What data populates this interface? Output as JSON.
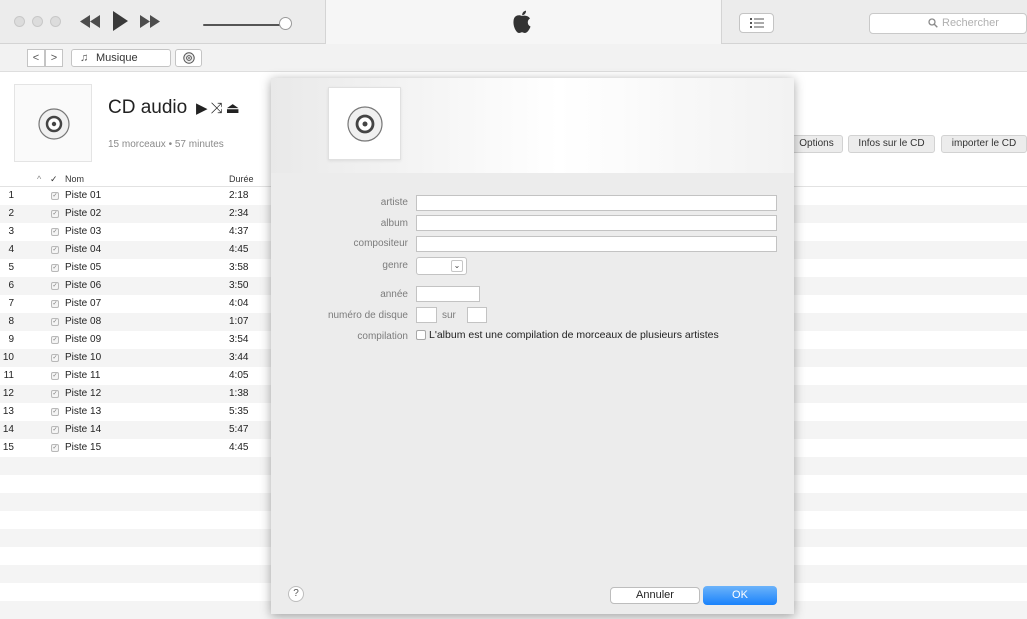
{
  "toolbar": {
    "search_placeholder": "Rechercher"
  },
  "nav": {
    "back": "<",
    "forward": ">",
    "library_label": "Musique"
  },
  "header": {
    "title": "CD audio",
    "meta": "15 morceaux • 57 minutes",
    "buttons": {
      "options": "Options",
      "cd_info": "Infos sur le CD",
      "import": "importer le CD"
    }
  },
  "tracklist": {
    "columns": {
      "check": "✓",
      "name": "Nom",
      "duration": "Durée"
    },
    "tracks": [
      {
        "num": "1",
        "name": "Piste 01",
        "duration": "2:18"
      },
      {
        "num": "2",
        "name": "Piste 02",
        "duration": "2:34"
      },
      {
        "num": "3",
        "name": "Piste 03",
        "duration": "4:37"
      },
      {
        "num": "4",
        "name": "Piste 04",
        "duration": "4:45"
      },
      {
        "num": "5",
        "name": "Piste 05",
        "duration": "3:58"
      },
      {
        "num": "6",
        "name": "Piste 06",
        "duration": "3:50"
      },
      {
        "num": "7",
        "name": "Piste 07",
        "duration": "4:04"
      },
      {
        "num": "8",
        "name": "Piste 08",
        "duration": "1:07"
      },
      {
        "num": "9",
        "name": "Piste 09",
        "duration": "3:54"
      },
      {
        "num": "10",
        "name": "Piste 10",
        "duration": "3:44"
      },
      {
        "num": "11",
        "name": "Piste 11",
        "duration": "4:05"
      },
      {
        "num": "12",
        "name": "Piste 12",
        "duration": "1:38"
      },
      {
        "num": "13",
        "name": "Piste 13",
        "duration": "5:35"
      },
      {
        "num": "14",
        "name": "Piste 14",
        "duration": "5:47"
      },
      {
        "num": "15",
        "name": "Piste 15",
        "duration": "4:45"
      }
    ]
  },
  "dialog": {
    "labels": {
      "artist": "artiste",
      "album": "album",
      "composer": "compositeur",
      "genre": "genre",
      "year": "année",
      "disc_number": "numéro de disque",
      "disc_of": "sur",
      "compilation": "compilation"
    },
    "values": {
      "artist": "",
      "album": "",
      "composer": "",
      "year": "",
      "disc_number": "",
      "disc_total": ""
    },
    "compilation_checked": false,
    "compilation_text": "L'album est une compilation de morceaux de plusieurs artistes",
    "help": "?",
    "cancel": "Annuler",
    "ok": "OK"
  },
  "colors": {
    "accent": "#1a82fb",
    "stripe": "#f4f4f4",
    "toolbar": "#ececec"
  }
}
